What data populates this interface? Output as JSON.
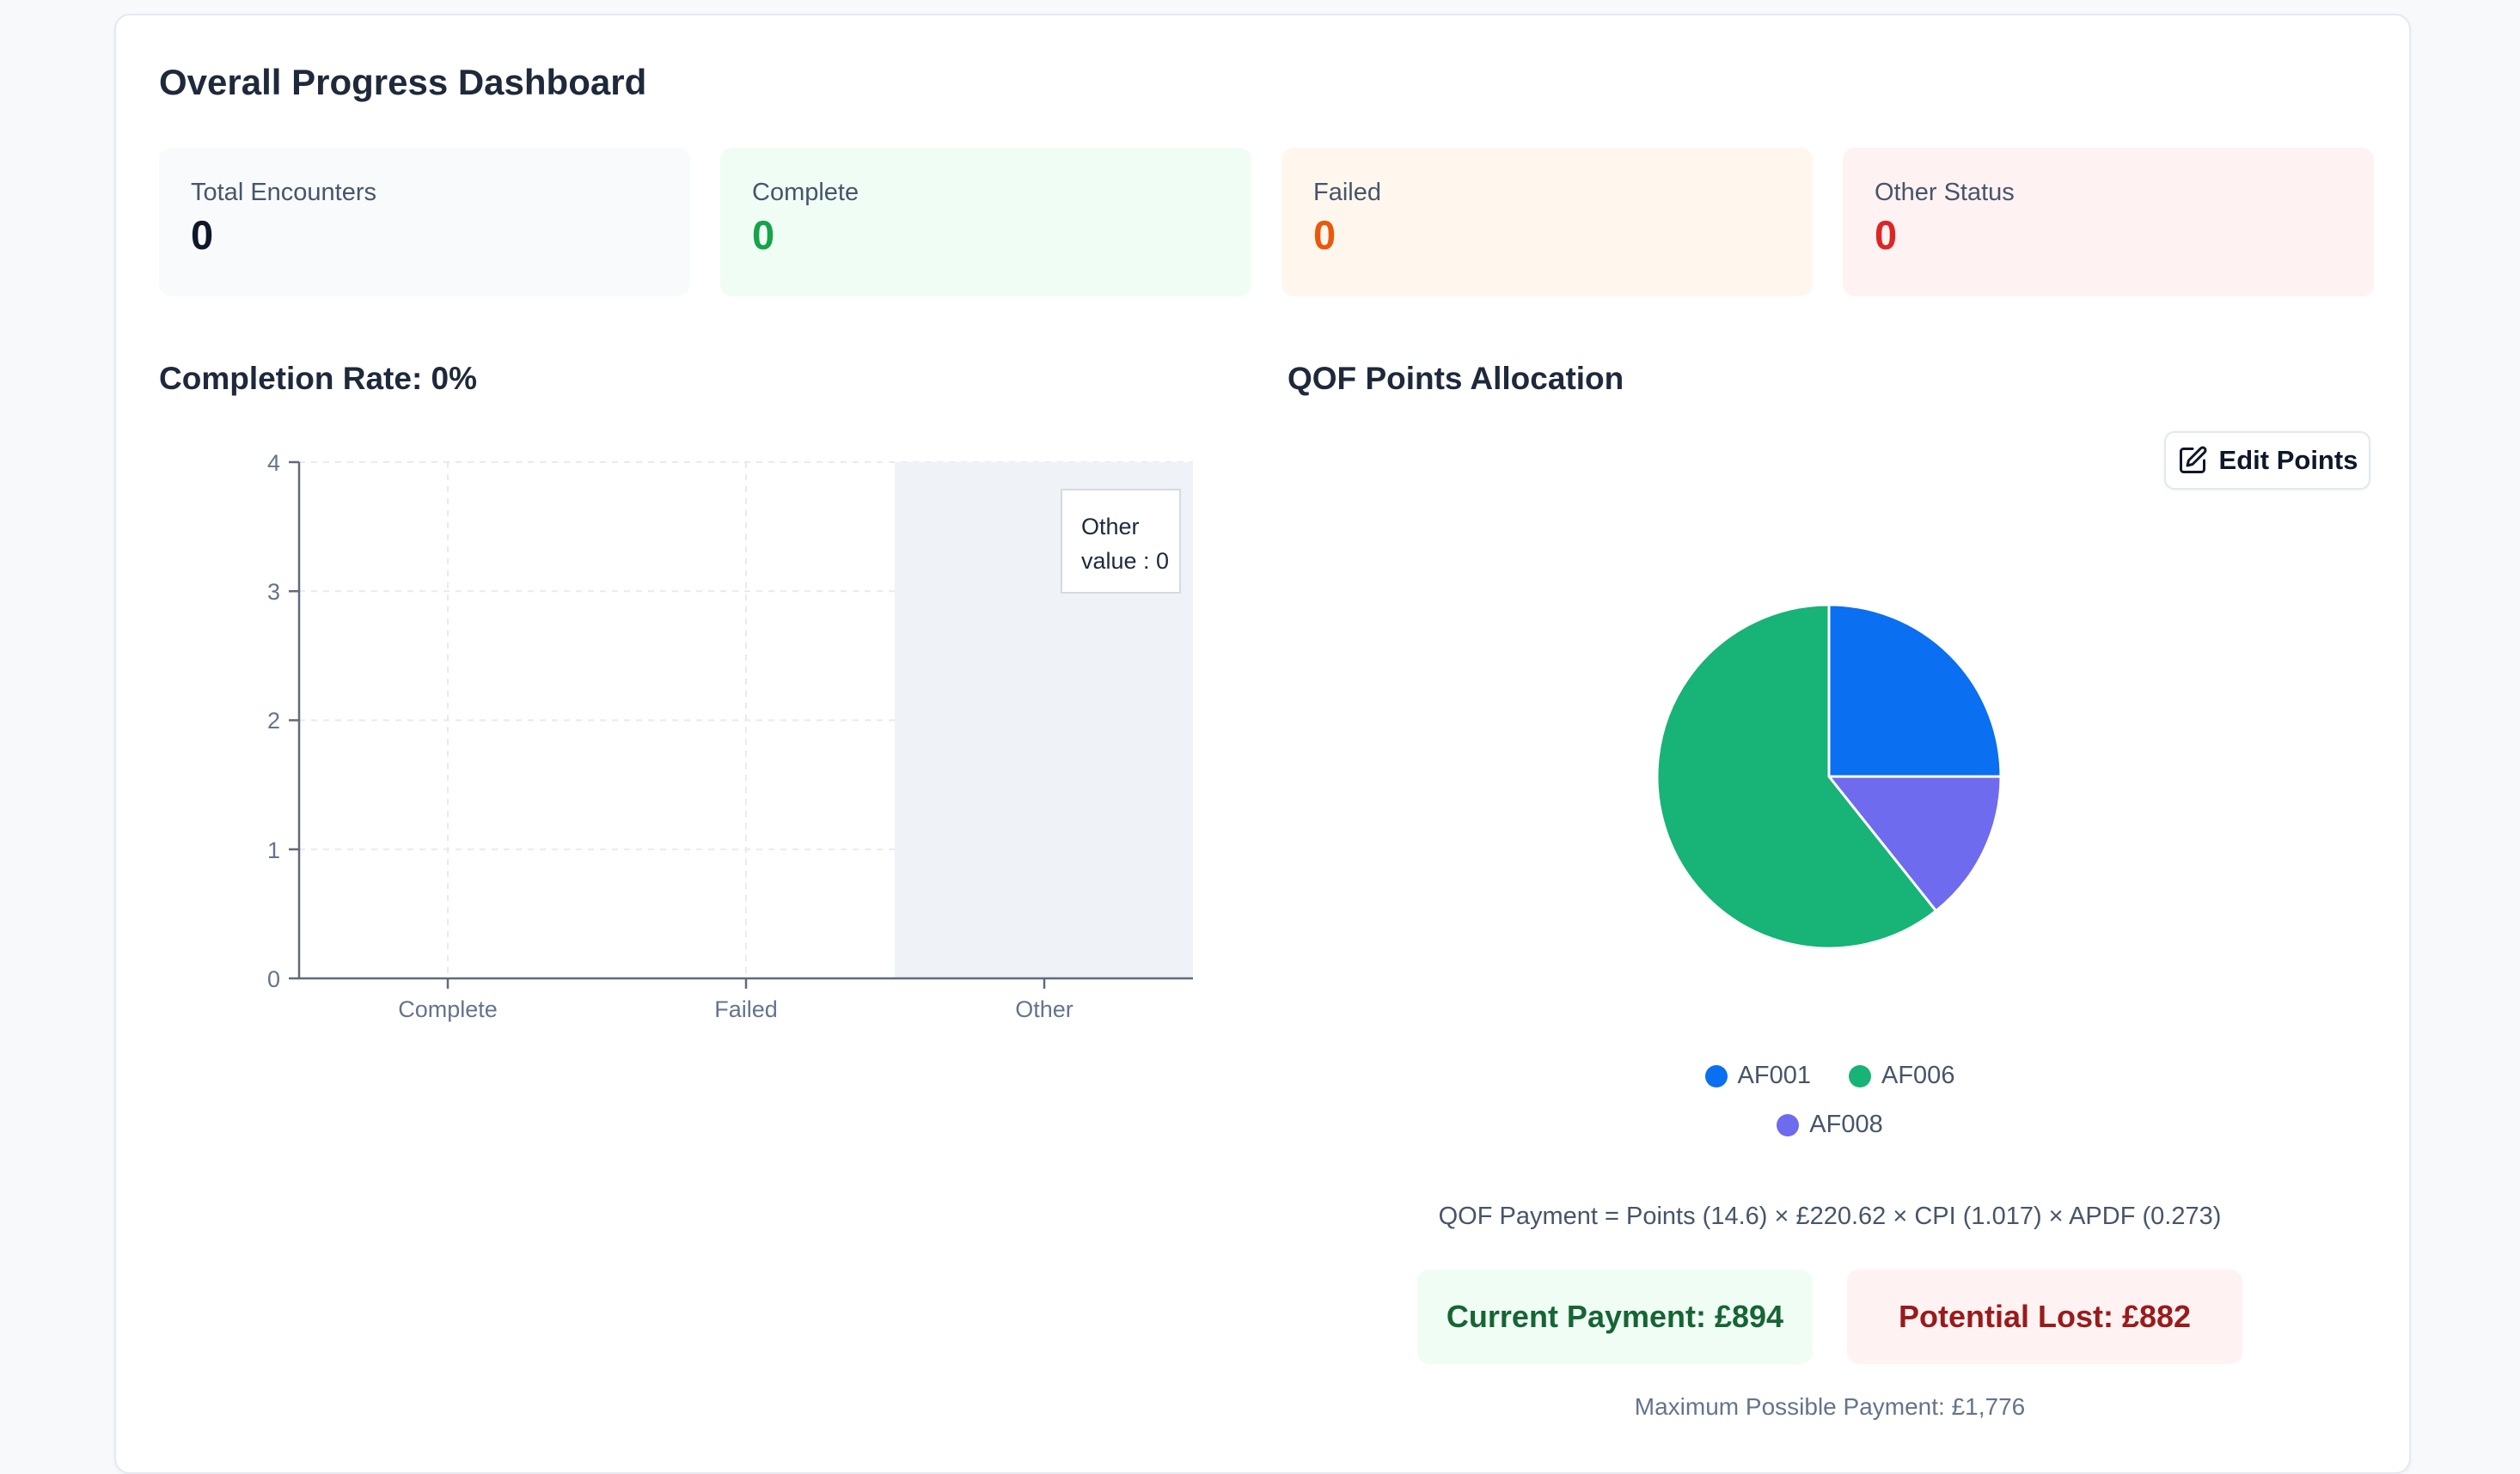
{
  "window": {
    "title": "Overall Progress Dashboard"
  },
  "stats": [
    {
      "label": "Total Encounters",
      "value": "0",
      "bg": "#f8fafc",
      "value_color": "#0f172a"
    },
    {
      "label": "Complete",
      "value": "0",
      "bg": "#f0fdf4",
      "value_color": "#16a34a"
    },
    {
      "label": "Failed",
      "value": "0",
      "bg": "#fff7ed",
      "value_color": "#ea580c"
    },
    {
      "label": "Other Status",
      "value": "0",
      "bg": "#fef2f2",
      "value_color": "#dc2626"
    }
  ],
  "sections": {
    "completion_heading": "Completion Rate: 0%",
    "qof_heading": "QOF Points Allocation"
  },
  "qof": {
    "edit_button": "Edit Points",
    "formula": "QOF Payment = Points (14.6) × £220.62 × CPI (1.017) × APDF (0.273)",
    "current_payment": "Current Payment: £894",
    "potential_lost": "Potential Lost: £882",
    "max_payment": "Maximum Possible Payment: £1,776"
  },
  "chart_data": [
    {
      "type": "bar",
      "title": "Completion Rate: 0%",
      "categories": [
        "Complete",
        "Failed",
        "Other"
      ],
      "values": [
        0,
        0,
        0
      ],
      "xlabel": "",
      "ylabel": "",
      "ylim": [
        0,
        4
      ],
      "yticks": [
        0,
        1,
        2,
        3,
        4
      ],
      "grid": true,
      "active_category": "Other",
      "tooltip": {
        "label": "Other",
        "value_line": "value : 0"
      }
    },
    {
      "type": "pie",
      "title": "QOF Points Allocation",
      "labels": [
        "AF001",
        "AF006",
        "AF008"
      ],
      "percents": [
        25,
        60.7,
        14.3
      ],
      "colors": {
        "AF001": "#0a6ff0",
        "AF006": "#17b377",
        "AF008": "#6e6bef"
      },
      "slices": [
        {
          "label": "AF001",
          "percent": 25,
          "color": "#0a6ff0"
        },
        {
          "label": "AF008",
          "percent": 14.3,
          "color": "#6e6bef"
        },
        {
          "label": "AF006",
          "percent": 60.7,
          "color": "#17b377"
        }
      ],
      "legend_position": "bottom"
    }
  ]
}
